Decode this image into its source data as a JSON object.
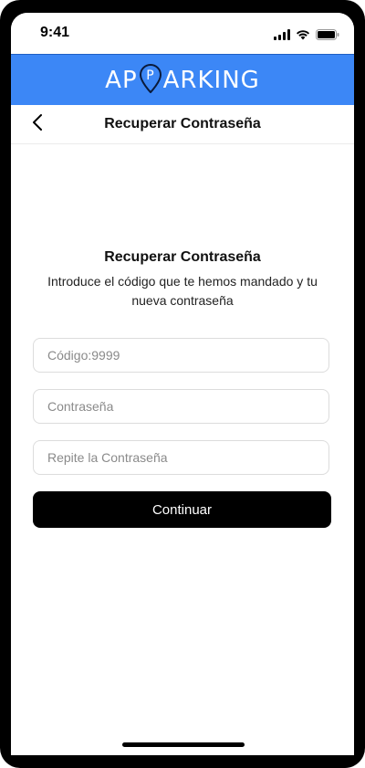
{
  "status_bar": {
    "time": "9:41",
    "icons": [
      "cellular-signal-icon",
      "wifi-icon",
      "battery-icon"
    ]
  },
  "brand": {
    "text_before": "AP",
    "pin_letter": "P",
    "text_after": "ARKING",
    "icon": "location-pin-icon"
  },
  "nav": {
    "back_icon": "chevron-left-icon",
    "title": "Recuperar Contraseña"
  },
  "content": {
    "title": "Recuperar Contraseña",
    "subtitle": "Introduce el código que te hemos mandado y tu nueva contraseña"
  },
  "form": {
    "code_placeholder": "Código:9999",
    "password_placeholder": "Contraseña",
    "repeat_password_placeholder": "Repite la Contraseña",
    "submit_label": "Continuar"
  },
  "colors": {
    "brand_blue": "#3c87f6",
    "button_black": "#000000"
  }
}
